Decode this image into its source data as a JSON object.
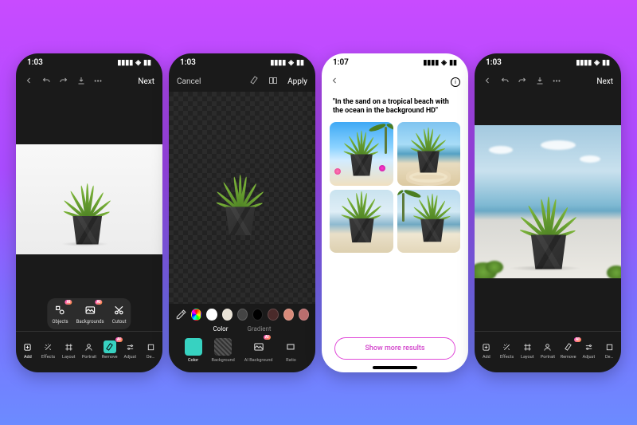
{
  "colors": {
    "accent_teal": "#37d2c1",
    "accent_pink": "#e048d8",
    "ai_gradient_from": "#ff4fd8",
    "ai_gradient_to": "#ff9a3c"
  },
  "ai_badge": "AI",
  "screen1": {
    "time": "1:03",
    "nav_next": "Next",
    "popup": {
      "objects": "Objects",
      "backgrounds": "Backgrounds",
      "cutout": "Cutout"
    },
    "tools": {
      "add": "Add",
      "effects": "Effects",
      "layout": "Layout",
      "portrait": "Portrait",
      "remove": "Remove",
      "adjust": "Adjust",
      "extra": "De…"
    }
  },
  "screen2": {
    "time": "1:03",
    "nav_cancel": "Cancel",
    "nav_apply": "Apply",
    "swatches": [
      "#ffffff",
      "#e9e2d6",
      "#444444",
      "#000000",
      "#4a2a2a",
      "#d98a7a",
      "#bb6e6e"
    ],
    "tabs": {
      "color": "Color",
      "gradient": "Gradient"
    },
    "sub": {
      "color": "Color",
      "background": "Background",
      "ai_background": "AI Background",
      "ratio": "Ratio"
    }
  },
  "screen3": {
    "time": "1:07",
    "prompt": "\"In the sand on a tropical beach with the ocean in the background HD\"",
    "show_more": "Show more results"
  },
  "screen4": {
    "time": "1:03",
    "nav_next": "Next",
    "tools": {
      "add": "Add",
      "effects": "Effects",
      "layout": "Layout",
      "portrait": "Portrait",
      "remove": "Remove",
      "adjust": "Adjust",
      "extra": "De…"
    }
  }
}
